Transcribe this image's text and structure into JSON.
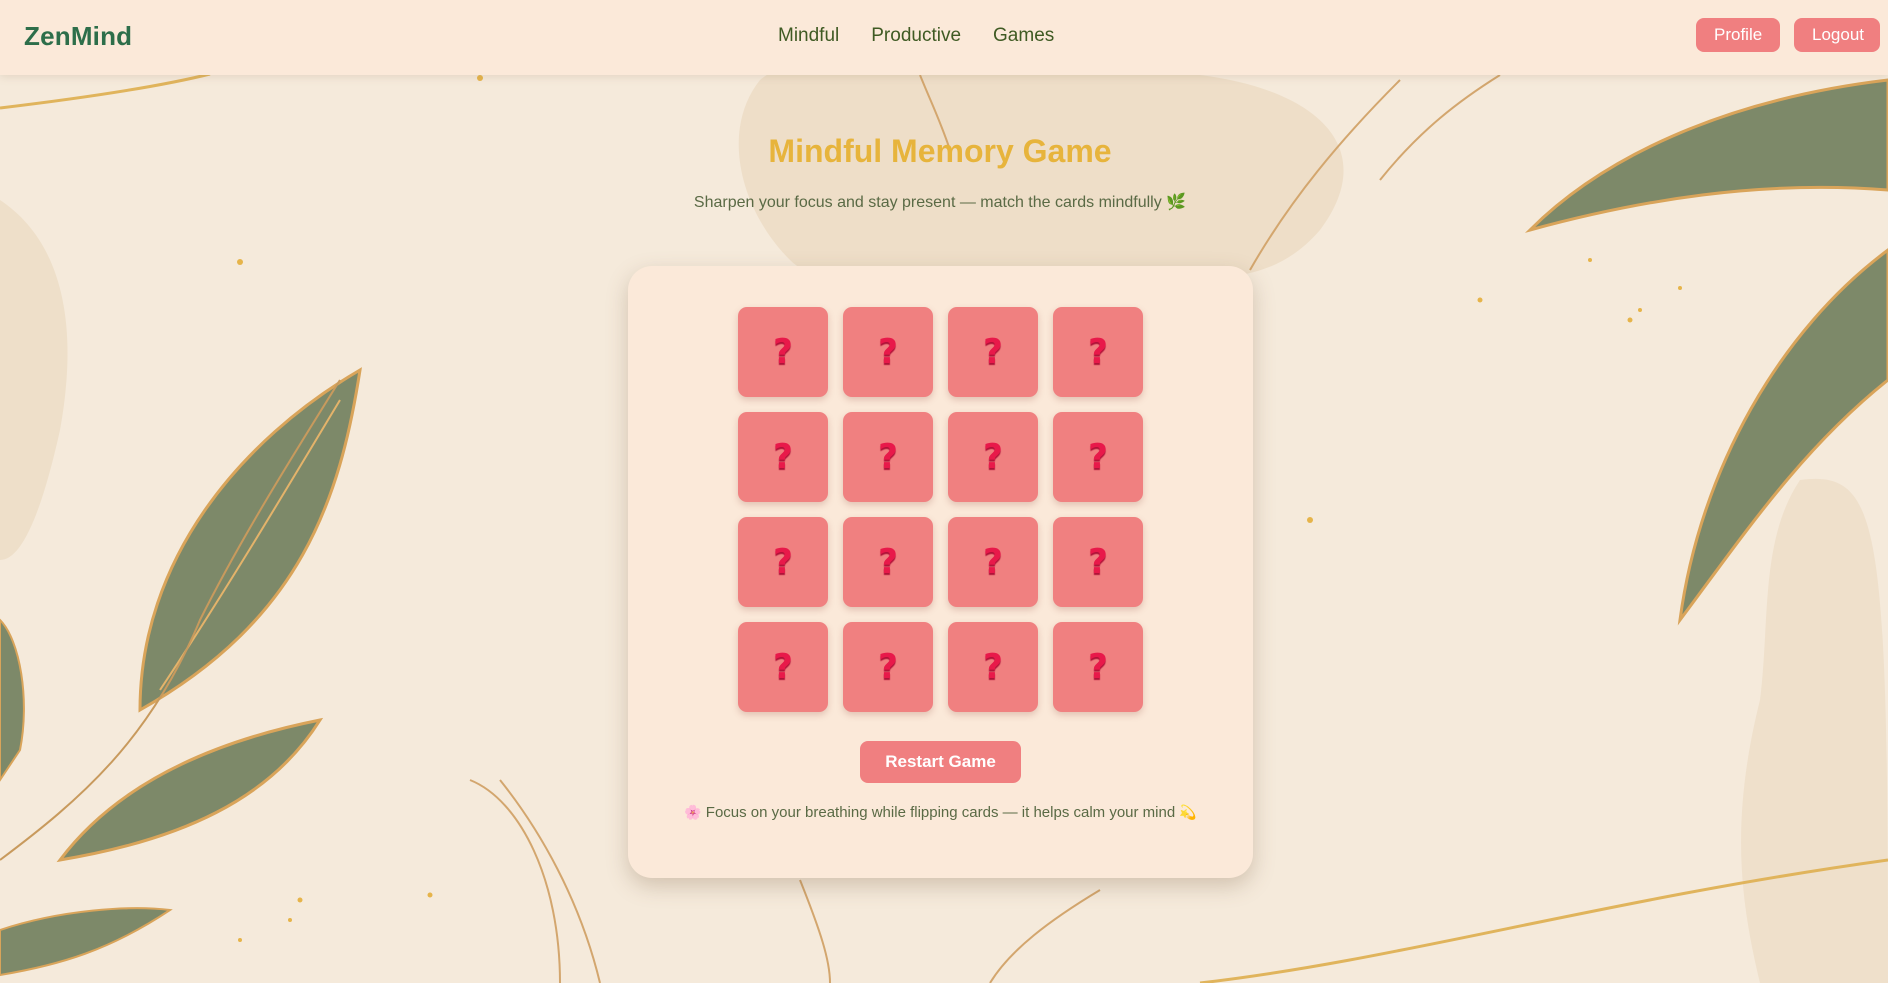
{
  "navbar": {
    "brand": "ZenMind",
    "links": [
      "Mindful",
      "Productive",
      "Games"
    ],
    "profile_label": "Profile",
    "logout_label": "Logout"
  },
  "game": {
    "title": "Mindful Memory Game",
    "subtitle": "Sharpen your focus and stay present — match the cards mindfully",
    "subtitle_icon": "🌿",
    "card_symbol": "?",
    "card_count": 16,
    "restart_label": "Restart Game",
    "tip_icon": "🌸",
    "tip_text": "Focus on your breathing while flipping cards — it helps calm your mind",
    "tip_end_icon": "💫"
  },
  "colors": {
    "accent": "#f07f80",
    "brand": "#2d6e4a",
    "title": "#e7b43c",
    "background": "#f5eadb",
    "panel": "#fbe9d9"
  }
}
